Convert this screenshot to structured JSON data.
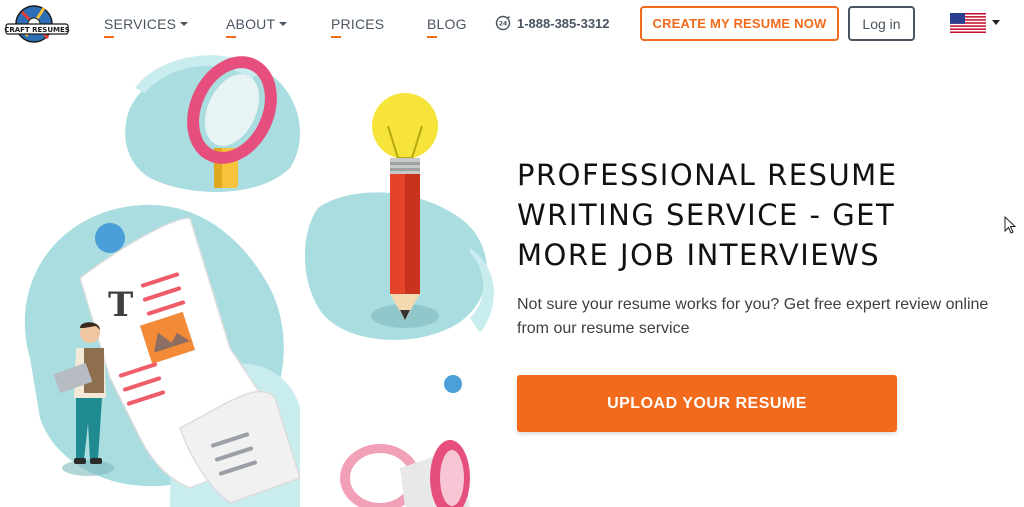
{
  "header": {
    "logo_text": "CRAFT RESUMES",
    "nav": [
      {
        "label": "SERVICES",
        "has_dropdown": true
      },
      {
        "label": "ABOUT",
        "has_dropdown": true
      },
      {
        "label": "PRICES",
        "has_dropdown": false
      },
      {
        "label": "BLOG",
        "has_dropdown": false
      }
    ],
    "phone_icon": "phone-24-icon",
    "phone": "1-888-385-3312",
    "cta_label": "CREATE MY RESUME NOW",
    "login_label": "Log in",
    "language_flag": "us-flag-icon"
  },
  "hero": {
    "title_lines": [
      "PROFESSIONAL RESUME",
      "WRITING SERVICE - GET",
      "MORE JOB INTERVIEWS"
    ],
    "subtitle": "Not sure your resume works for you? Get free expert review online from our resume service",
    "upload_label": "UPLOAD YOUR RESUME"
  },
  "illustration": {
    "doc_letter": "T"
  },
  "colors": {
    "accent": "#f26a1b",
    "nav_text": "#4a5561",
    "teal": "#a9dde0",
    "pink": "#e64f7d",
    "yellow": "#f6e43a"
  }
}
